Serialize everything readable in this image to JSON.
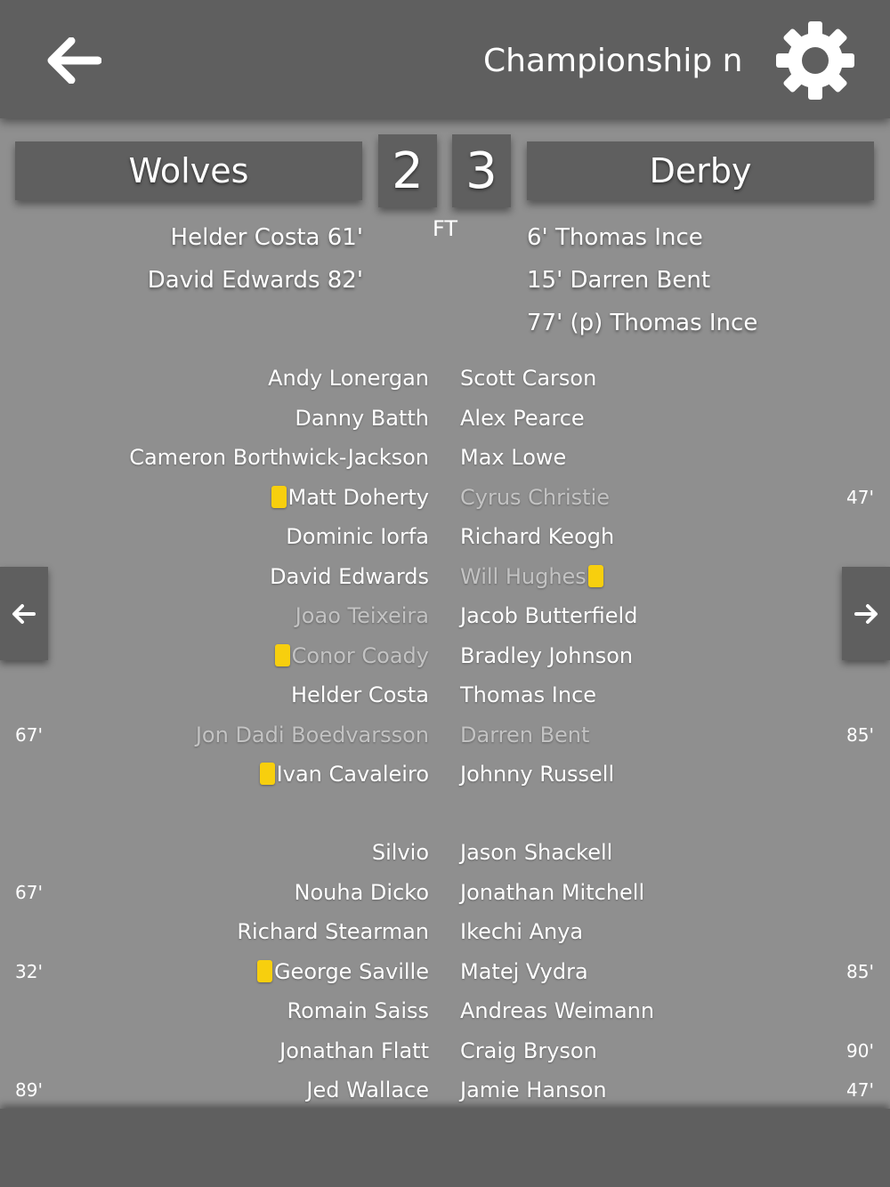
{
  "header": {
    "title": "Championship news",
    "back_icon": "arrow-left-icon",
    "settings_icon": "gear-icon"
  },
  "match": {
    "home_team": "Wolves",
    "away_team": "Derby",
    "home_score": "2",
    "away_score": "3",
    "status": "FT"
  },
  "goals": {
    "home": [
      "Helder Costa 61'",
      "David Edwards 82'"
    ],
    "away": [
      "6' Thomas Ince",
      "15' Darren Bent",
      "77' (p) Thomas Ince"
    ]
  },
  "lineups": {
    "starters": {
      "home": [
        {
          "name": "Andy Lonergan",
          "card": false,
          "dim": false,
          "minute": ""
        },
        {
          "name": "Danny Batth",
          "card": false,
          "dim": false,
          "minute": ""
        },
        {
          "name": "Cameron Borthwick-Jackson",
          "card": false,
          "dim": false,
          "minute": ""
        },
        {
          "name": "Matt Doherty",
          "card": true,
          "dim": false,
          "minute": ""
        },
        {
          "name": "Dominic Iorfa",
          "card": false,
          "dim": false,
          "minute": ""
        },
        {
          "name": "David Edwards",
          "card": false,
          "dim": false,
          "minute": ""
        },
        {
          "name": "Joao Teixeira",
          "card": false,
          "dim": true,
          "minute": ""
        },
        {
          "name": "Conor Coady",
          "card": true,
          "dim": true,
          "minute": ""
        },
        {
          "name": "Helder Costa",
          "card": false,
          "dim": false,
          "minute": ""
        },
        {
          "name": "Jon Dadi Boedvarsson",
          "card": false,
          "dim": true,
          "minute": "67'"
        },
        {
          "name": "Ivan Cavaleiro",
          "card": true,
          "dim": false,
          "minute": ""
        }
      ],
      "away": [
        {
          "name": "Scott Carson",
          "card": false,
          "dim": false,
          "minute": ""
        },
        {
          "name": "Alex Pearce",
          "card": false,
          "dim": false,
          "minute": ""
        },
        {
          "name": "Max Lowe",
          "card": false,
          "dim": false,
          "minute": ""
        },
        {
          "name": "Cyrus Christie",
          "card": false,
          "dim": true,
          "minute": "47'"
        },
        {
          "name": "Richard Keogh",
          "card": false,
          "dim": false,
          "minute": ""
        },
        {
          "name": "Will Hughes",
          "card": true,
          "dim": true,
          "minute": ""
        },
        {
          "name": "Jacob Butterfield",
          "card": false,
          "dim": false,
          "minute": ""
        },
        {
          "name": "Bradley Johnson",
          "card": false,
          "dim": false,
          "minute": ""
        },
        {
          "name": "Thomas Ince",
          "card": false,
          "dim": false,
          "minute": ""
        },
        {
          "name": "Darren Bent",
          "card": false,
          "dim": true,
          "minute": "85'"
        },
        {
          "name": "Johnny Russell",
          "card": false,
          "dim": false,
          "minute": ""
        }
      ]
    },
    "subs": {
      "home": [
        {
          "name": "Silvio",
          "card": false,
          "dim": false,
          "minute": ""
        },
        {
          "name": "Nouha Dicko",
          "card": false,
          "dim": false,
          "minute": "67'"
        },
        {
          "name": "Richard Stearman",
          "card": false,
          "dim": false,
          "minute": ""
        },
        {
          "name": "George Saville",
          "card": true,
          "dim": false,
          "minute": "32'"
        },
        {
          "name": "Romain Saiss",
          "card": false,
          "dim": false,
          "minute": ""
        },
        {
          "name": "Jonathan Flatt",
          "card": false,
          "dim": false,
          "minute": ""
        },
        {
          "name": "Jed Wallace",
          "card": false,
          "dim": false,
          "minute": "89'"
        }
      ],
      "away": [
        {
          "name": "Jason Shackell",
          "card": false,
          "dim": false,
          "minute": ""
        },
        {
          "name": "Jonathan Mitchell",
          "card": false,
          "dim": false,
          "minute": ""
        },
        {
          "name": "Ikechi Anya",
          "card": false,
          "dim": false,
          "minute": ""
        },
        {
          "name": "Matej Vydra",
          "card": false,
          "dim": false,
          "minute": "85'"
        },
        {
          "name": "Andreas Weimann",
          "card": false,
          "dim": false,
          "minute": ""
        },
        {
          "name": "Craig Bryson",
          "card": false,
          "dim": false,
          "minute": "90'"
        },
        {
          "name": "Jamie Hanson",
          "card": false,
          "dim": false,
          "minute": "47'"
        }
      ]
    }
  },
  "nav": {
    "prev_icon": "arrow-left-icon",
    "next_icon": "arrow-right-icon"
  },
  "colors": {
    "background": "#8f8f8f",
    "bar": "#5f5f5f",
    "card": "#f7cf0e",
    "dim_text": "#c3c3c3"
  }
}
